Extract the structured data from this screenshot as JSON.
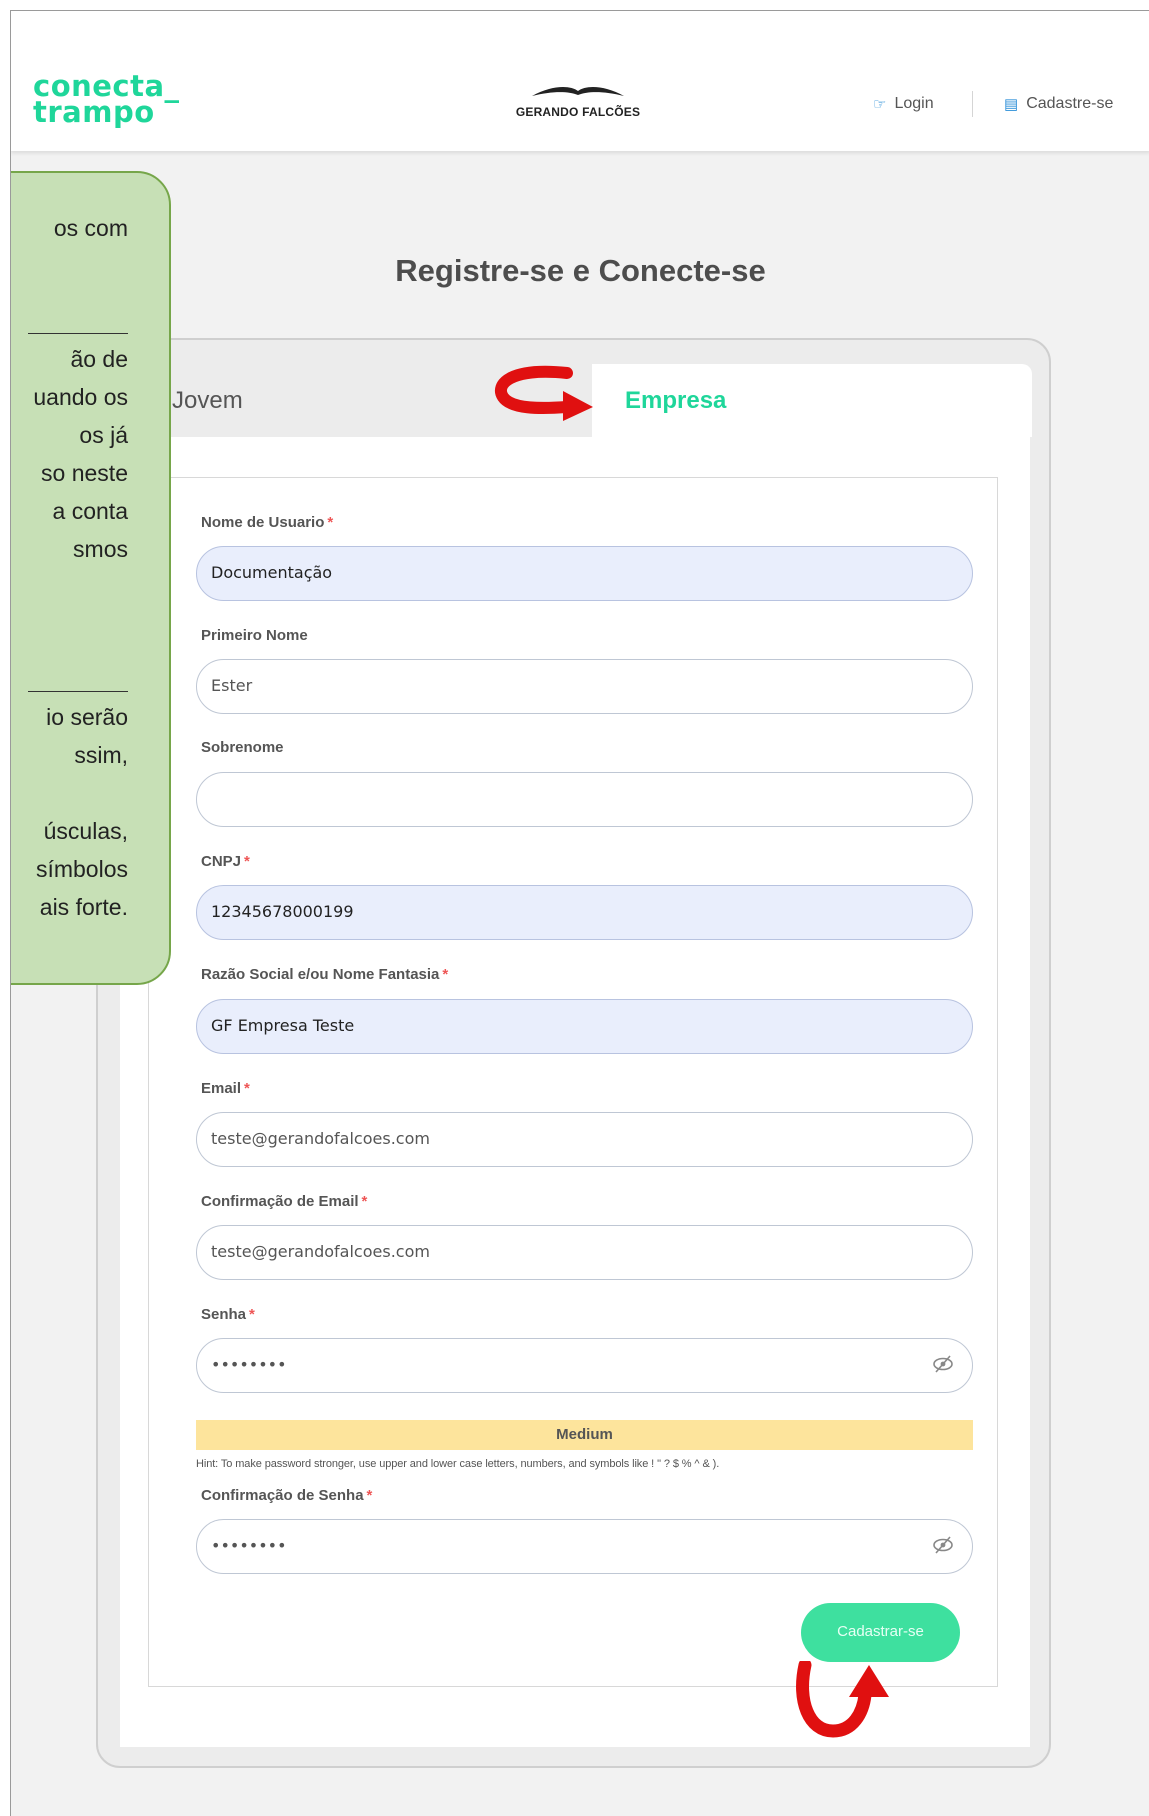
{
  "header": {
    "logo_line1": "conecta_",
    "logo_line2": "trampo",
    "brand_name": "GERANDO FALCÕES",
    "nav": {
      "login": "Login",
      "register": "Cadastre-se"
    }
  },
  "page_title": "Registre-se e Conecte-se",
  "tabs": {
    "jovem": "Jovem",
    "empresa": "Empresa"
  },
  "form": {
    "username": {
      "label": "Nome de Usuario",
      "required": "*",
      "value": "Documentação"
    },
    "first_name": {
      "label": "Primeiro Nome",
      "value": "Ester"
    },
    "last_name": {
      "label": "Sobrenome",
      "value": ""
    },
    "cnpj": {
      "label": "CNPJ",
      "required": "*",
      "value": "12345678000199"
    },
    "company_name": {
      "label": "Razão Social e/ou Nome Fantasia",
      "required": "*",
      "value": "GF Empresa Teste"
    },
    "email": {
      "label": "Email",
      "required": "*",
      "value": "teste@gerandofalcoes.com"
    },
    "email_confirm": {
      "label": "Confirmação de Email",
      "required": "*",
      "value": "teste@gerandofalcoes.com"
    },
    "password": {
      "label": "Senha",
      "required": "*",
      "value": "••••••••"
    },
    "password_strength": "Medium",
    "password_hint": "Hint: To make password stronger, use upper and lower case letters, numbers, and symbols like ! \" ? $ % ^ & ).",
    "password_confirm": {
      "label": "Confirmação de Senha",
      "required": "*",
      "value": "••••••••"
    },
    "submit": "Cadastrar-se"
  },
  "callout_note": {
    "lines_a": [
      "os com"
    ],
    "lines_b": [
      "ão de",
      "uando os",
      "os já",
      "so neste",
      "a conta",
      "smos"
    ],
    "lines_c": [
      "io serão",
      "ssim,",
      "úsculas,",
      "símbolos",
      "ais forte."
    ]
  },
  "colors": {
    "accent": "#1fd69a",
    "button": "#3ee09f",
    "strength_medium": "#fde49c",
    "callout_fill": "#c7e0b6",
    "annotation_arrow": "#e01010"
  },
  "icons": {
    "login": "hand-pointer-icon",
    "register": "id-card-icon",
    "eye": "eye-slash-icon"
  }
}
